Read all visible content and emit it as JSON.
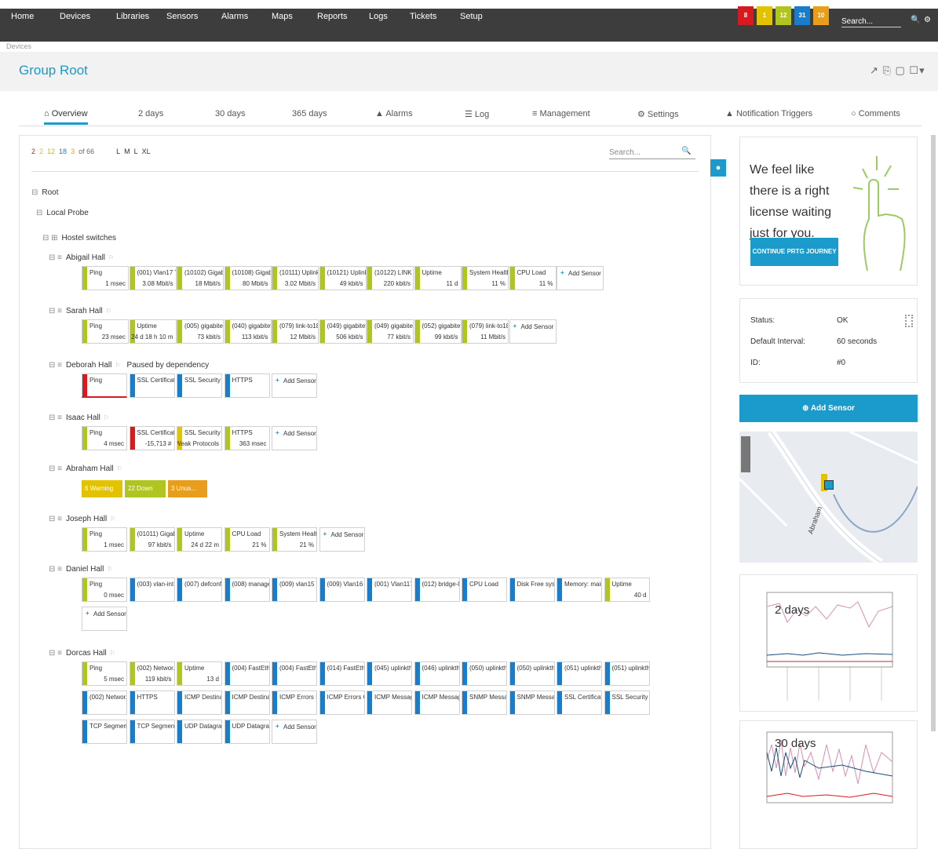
{
  "nav": {
    "items": [
      "Home",
      "Devices",
      "Libraries",
      "Sensors",
      "Alarms",
      "Maps",
      "Reports",
      "Logs",
      "Tickets",
      "Setup"
    ],
    "status_boxes": [
      {
        "label": "8",
        "color": "#d71920"
      },
      {
        "label": "1",
        "color": "#e3c300"
      },
      {
        "label": "12",
        "color": "#b0c520"
      },
      {
        "label": "31",
        "color": "#1a7dcb"
      },
      {
        "label": "10",
        "color": "#e89e1a"
      }
    ],
    "search_placeholder": "Search..."
  },
  "breadcrumb": "Devices",
  "page_title": "Group Root",
  "toolbar_icons": "↗ ⎘ ▢ ☐▾",
  "tabs": [
    "Overview",
    "2 days",
    "30 days",
    "365 days",
    "Alarms",
    "Log",
    "Management",
    "Settings",
    "Notification Triggers",
    "Comments"
  ],
  "tree_toolbar": {
    "items": [
      "2",
      "2",
      "12",
      "18",
      "3",
      "of 66",
      "L",
      "M",
      "L",
      "XL"
    ],
    "search_placeholder": "Search..."
  },
  "tree": {
    "root": "Root",
    "probe": "Local Probe",
    "group": "Hostel switches",
    "devices": [
      {
        "name": "Abigail Hall",
        "sensors": [
          {
            "n": "Ping",
            "v": "1 msec",
            "s": "up"
          },
          {
            "n": "(001) Vlan17 T...",
            "v": "3.08 Mbit/s",
            "s": "up"
          },
          {
            "n": "(10102) Gigab...",
            "v": "18 Mbit/s",
            "s": "up"
          },
          {
            "n": "(10108) Gigab...",
            "v": "80 Mbit/s",
            "s": "up"
          },
          {
            "n": "(10111) Uplink...",
            "v": "3.02 Mbit/s",
            "s": "up"
          },
          {
            "n": "(10121) Uplink...",
            "v": "49 kbit/s",
            "s": "up"
          },
          {
            "n": "(10122) LINK T...",
            "v": "220 kbit/s",
            "s": "up"
          },
          {
            "n": "Uptime",
            "v": "11 d",
            "s": "up"
          },
          {
            "n": "System Health ...",
            "v": "11 %",
            "s": "up"
          },
          {
            "n": "CPU Load",
            "v": "11 %",
            "s": "up"
          },
          {
            "n": "Add Sensor",
            "v": "",
            "s": "add"
          }
        ]
      },
      {
        "name": "Sarah Hall",
        "sensors": [
          {
            "n": "Ping",
            "v": "23 msec",
            "s": "up"
          },
          {
            "n": "Uptime",
            "v": "24 d 18 h 10 m",
            "s": "up"
          },
          {
            "n": "(005) gigabitet...",
            "v": "73 kbit/s",
            "s": "up"
          },
          {
            "n": "(040) gigabitet...",
            "v": "113 kbit/s",
            "s": "up"
          },
          {
            "n": "(079) link-to18...",
            "v": "12 Mbit/s",
            "s": "up"
          },
          {
            "n": "(049) gigabitet...",
            "v": "506 kbit/s",
            "s": "up"
          },
          {
            "n": "(049) gigabitet...",
            "v": "77 kbit/s",
            "s": "up"
          },
          {
            "n": "(052) gigabitet...",
            "v": "99 kbit/s",
            "s": "up"
          },
          {
            "n": "(079) link-to18...",
            "v": "11 Mbit/s",
            "s": "up"
          },
          {
            "n": "Add Sensor",
            "v": "",
            "s": "add"
          }
        ]
      },
      {
        "name": "Deborah Hall",
        "note": "Paused by dependency",
        "sensors": [
          {
            "n": "Ping",
            "v": "",
            "s": "down"
          },
          {
            "n": "SSL Certificate...",
            "v": "",
            "s": "paused"
          },
          {
            "n": "SSL Security C...",
            "v": "",
            "s": "paused"
          },
          {
            "n": "HTTPS",
            "v": "",
            "s": "paused"
          },
          {
            "n": "Add Sensor",
            "v": "",
            "s": "add"
          }
        ]
      },
      {
        "name": "Isaac Hall",
        "sensors": [
          {
            "n": "Ping",
            "v": "4 msec",
            "s": "up"
          },
          {
            "n": "SSL Certificate...",
            "v": "-15,713 #",
            "s": "down"
          },
          {
            "n": "SSL Security C...",
            "v": "Weak Protocols",
            "s": "warn"
          },
          {
            "n": "HTTPS",
            "v": "363 msec",
            "s": "up"
          },
          {
            "n": "Add Sensor",
            "v": "",
            "s": "add"
          }
        ]
      },
      {
        "name": "Abraham Hall",
        "summary": [
          {
            "t": "6 Warning",
            "c": "#e3c300"
          },
          {
            "t": "22 Down",
            "c": "#b0c520"
          },
          {
            "t": "3 Unus...",
            "c": "#e89e1a"
          }
        ]
      },
      {
        "name": "Joseph Hall",
        "sensors": [
          {
            "n": "Ping",
            "v": "1 msec",
            "s": "up"
          },
          {
            "n": "(01011) Gigab...",
            "v": "97 kbit/s",
            "s": "up"
          },
          {
            "n": "Uptime",
            "v": "24 d 22 m",
            "s": "up"
          },
          {
            "n": "CPU Load",
            "v": "21 %",
            "s": "up"
          },
          {
            "n": "System Health ...",
            "v": "21 %",
            "s": "up"
          },
          {
            "n": "Add Sensor",
            "v": "",
            "s": "add"
          }
        ]
      },
      {
        "name": "Daniel Hall",
        "sensors": [
          {
            "n": "Ping",
            "v": "0 msec",
            "s": "up"
          },
          {
            "n": "(003) vlan-int...",
            "v": "",
            "s": "paused"
          },
          {
            "n": "(007) defconf...",
            "v": "",
            "s": "paused"
          },
          {
            "n": "(008) manage...",
            "v": "",
            "s": "paused"
          },
          {
            "n": "(009) vlan15 Tr...",
            "v": "",
            "s": "paused"
          },
          {
            "n": "(009) Vlan16 Tr...",
            "v": "",
            "s": "paused"
          },
          {
            "n": "(001) Vlan117...",
            "v": "",
            "s": "paused"
          },
          {
            "n": "(012) bridge-li...",
            "v": "",
            "s": "paused"
          },
          {
            "n": "CPU Load",
            "v": "",
            "s": "paused"
          },
          {
            "n": "Disk Free sys...",
            "v": "",
            "s": "paused"
          },
          {
            "n": "Memory: main...",
            "v": "",
            "s": "paused"
          },
          {
            "n": "Uptime",
            "v": "40 d",
            "s": "up"
          },
          {
            "n": "Add Sensor",
            "v": "",
            "s": "add"
          }
        ]
      },
      {
        "name": "Dorcas Hall",
        "sensors": [
          {
            "n": "Ping",
            "v": "5 msec",
            "s": "up"
          },
          {
            "n": "(002) Networ...",
            "v": "119 kbit/s",
            "s": "up"
          },
          {
            "n": "Uptime",
            "v": "13 d",
            "s": "up"
          },
          {
            "n": "(004) FastEthe...",
            "v": "",
            "s": "paused"
          },
          {
            "n": "(004) FastEthe...",
            "v": "",
            "s": "paused"
          },
          {
            "n": "(014) FastEthe...",
            "v": "",
            "s": "paused"
          },
          {
            "n": "(045) uplinkth...",
            "v": "",
            "s": "paused"
          },
          {
            "n": "(046) uplinkth...",
            "v": "",
            "s": "paused"
          },
          {
            "n": "(050) uplinkth...",
            "v": "",
            "s": "paused"
          },
          {
            "n": "(050) uplinkth...",
            "v": "",
            "s": "paused"
          },
          {
            "n": "(051) uplinkth...",
            "v": "",
            "s": "paused"
          },
          {
            "n": "(051) uplinkth...",
            "v": "",
            "s": "paused"
          },
          {
            "n": "(002) Networ...",
            "v": "",
            "s": "paused"
          },
          {
            "n": "HTTPS",
            "v": "",
            "s": "paused"
          },
          {
            "n": "ICMP Destinat...",
            "v": "",
            "s": "paused"
          },
          {
            "n": "ICMP Destinat...",
            "v": "",
            "s": "paused"
          },
          {
            "n": "ICMP Errors In",
            "v": "",
            "s": "paused"
          },
          {
            "n": "ICMP Errors Out",
            "v": "",
            "s": "paused"
          },
          {
            "n": "ICMP Messag...",
            "v": "",
            "s": "paused"
          },
          {
            "n": "ICMP Messag...",
            "v": "",
            "s": "paused"
          },
          {
            "n": "SNMP Messag...",
            "v": "",
            "s": "paused"
          },
          {
            "n": "SNMP Messag...",
            "v": "",
            "s": "paused"
          },
          {
            "n": "SSL Certificate...",
            "v": "",
            "s": "paused"
          },
          {
            "n": "SSL Security C...",
            "v": "",
            "s": "paused"
          },
          {
            "n": "TCP Segments...",
            "v": "",
            "s": "paused"
          },
          {
            "n": "TCP Segments...",
            "v": "",
            "s": "paused"
          },
          {
            "n": "UDP Datagram...",
            "v": "",
            "s": "paused"
          },
          {
            "n": "UDP Datagram...",
            "v": "",
            "s": "paused"
          },
          {
            "n": "Add Sensor",
            "v": "",
            "s": "add"
          }
        ]
      }
    ]
  },
  "status_colors": {
    "up": "#b0c520",
    "down": "#d71920",
    "warn": "#e3c300",
    "paused": "#1a7dcb"
  },
  "promo": {
    "text": "We feel like there is a right license waiting just for you.",
    "button": "CONTINUE PRTG JOURNEY"
  },
  "info": {
    "status_label": "Status:",
    "status_value": "OK",
    "interval_label": "Default Interval:",
    "interval_value": "60 seconds",
    "id_label": "ID:",
    "id_value": "#0"
  },
  "add_sensor": "Add Sensor",
  "map_label": "Abraham",
  "charts": [
    {
      "label": "2 days"
    },
    {
      "label": "30 days"
    }
  ]
}
